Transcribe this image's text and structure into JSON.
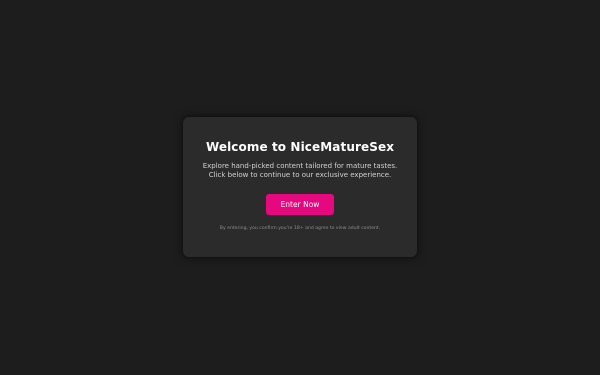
{
  "modal": {
    "title": "Welcome to NiceMatureSex",
    "description": "Explore hand-picked content tailored for mature tastes. Click below to continue to our exclusive experience.",
    "enter_label": "Enter Now",
    "disclaimer": "By entering, you confirm you're 18+ and agree to view adult content."
  },
  "colors": {
    "background": "#1d1d1d",
    "card": "#2b2b2b",
    "accent": "#e5087f"
  }
}
